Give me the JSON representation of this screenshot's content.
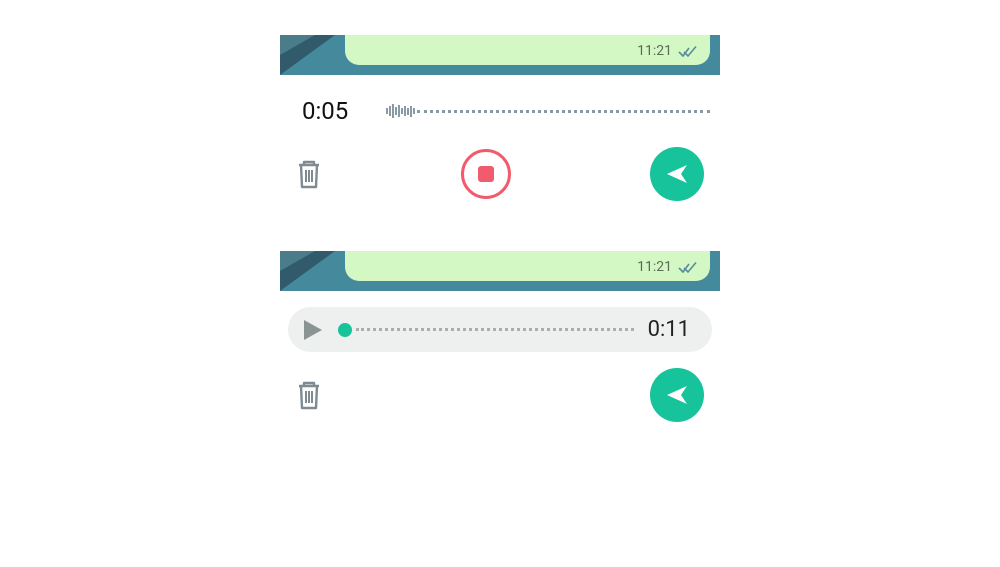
{
  "recording": {
    "bubble_time": "11:21",
    "elapsed": "0:05"
  },
  "preview": {
    "bubble_time": "11:21",
    "duration": "0:11"
  },
  "colors": {
    "accent": "#17c39b",
    "stop": "#f05c6c",
    "bubble": "#d4f8c4",
    "strip": "#448a9c"
  }
}
